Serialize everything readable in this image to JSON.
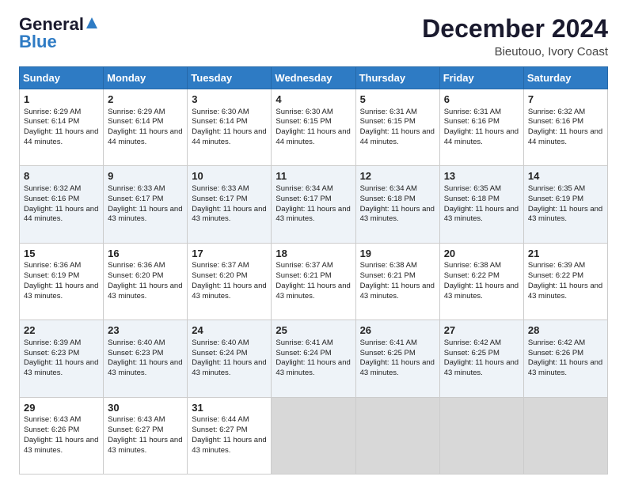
{
  "logo": {
    "line1": "General",
    "line2": "Blue"
  },
  "title": "December 2024",
  "subtitle": "Bieutouo, Ivory Coast",
  "days_of_week": [
    "Sunday",
    "Monday",
    "Tuesday",
    "Wednesday",
    "Thursday",
    "Friday",
    "Saturday"
  ],
  "weeks": [
    [
      {
        "day": "1",
        "sunrise": "6:29 AM",
        "sunset": "6:14 PM",
        "daylight": "11 hours and 44 minutes."
      },
      {
        "day": "2",
        "sunrise": "6:29 AM",
        "sunset": "6:14 PM",
        "daylight": "11 hours and 44 minutes."
      },
      {
        "day": "3",
        "sunrise": "6:30 AM",
        "sunset": "6:14 PM",
        "daylight": "11 hours and 44 minutes."
      },
      {
        "day": "4",
        "sunrise": "6:30 AM",
        "sunset": "6:15 PM",
        "daylight": "11 hours and 44 minutes."
      },
      {
        "day": "5",
        "sunrise": "6:31 AM",
        "sunset": "6:15 PM",
        "daylight": "11 hours and 44 minutes."
      },
      {
        "day": "6",
        "sunrise": "6:31 AM",
        "sunset": "6:16 PM",
        "daylight": "11 hours and 44 minutes."
      },
      {
        "day": "7",
        "sunrise": "6:32 AM",
        "sunset": "6:16 PM",
        "daylight": "11 hours and 44 minutes."
      }
    ],
    [
      {
        "day": "8",
        "sunrise": "6:32 AM",
        "sunset": "6:16 PM",
        "daylight": "11 hours and 44 minutes."
      },
      {
        "day": "9",
        "sunrise": "6:33 AM",
        "sunset": "6:17 PM",
        "daylight": "11 hours and 43 minutes."
      },
      {
        "day": "10",
        "sunrise": "6:33 AM",
        "sunset": "6:17 PM",
        "daylight": "11 hours and 43 minutes."
      },
      {
        "day": "11",
        "sunrise": "6:34 AM",
        "sunset": "6:17 PM",
        "daylight": "11 hours and 43 minutes."
      },
      {
        "day": "12",
        "sunrise": "6:34 AM",
        "sunset": "6:18 PM",
        "daylight": "11 hours and 43 minutes."
      },
      {
        "day": "13",
        "sunrise": "6:35 AM",
        "sunset": "6:18 PM",
        "daylight": "11 hours and 43 minutes."
      },
      {
        "day": "14",
        "sunrise": "6:35 AM",
        "sunset": "6:19 PM",
        "daylight": "11 hours and 43 minutes."
      }
    ],
    [
      {
        "day": "15",
        "sunrise": "6:36 AM",
        "sunset": "6:19 PM",
        "daylight": "11 hours and 43 minutes."
      },
      {
        "day": "16",
        "sunrise": "6:36 AM",
        "sunset": "6:20 PM",
        "daylight": "11 hours and 43 minutes."
      },
      {
        "day": "17",
        "sunrise": "6:37 AM",
        "sunset": "6:20 PM",
        "daylight": "11 hours and 43 minutes."
      },
      {
        "day": "18",
        "sunrise": "6:37 AM",
        "sunset": "6:21 PM",
        "daylight": "11 hours and 43 minutes."
      },
      {
        "day": "19",
        "sunrise": "6:38 AM",
        "sunset": "6:21 PM",
        "daylight": "11 hours and 43 minutes."
      },
      {
        "day": "20",
        "sunrise": "6:38 AM",
        "sunset": "6:22 PM",
        "daylight": "11 hours and 43 minutes."
      },
      {
        "day": "21",
        "sunrise": "6:39 AM",
        "sunset": "6:22 PM",
        "daylight": "11 hours and 43 minutes."
      }
    ],
    [
      {
        "day": "22",
        "sunrise": "6:39 AM",
        "sunset": "6:23 PM",
        "daylight": "11 hours and 43 minutes."
      },
      {
        "day": "23",
        "sunrise": "6:40 AM",
        "sunset": "6:23 PM",
        "daylight": "11 hours and 43 minutes."
      },
      {
        "day": "24",
        "sunrise": "6:40 AM",
        "sunset": "6:24 PM",
        "daylight": "11 hours and 43 minutes."
      },
      {
        "day": "25",
        "sunrise": "6:41 AM",
        "sunset": "6:24 PM",
        "daylight": "11 hours and 43 minutes."
      },
      {
        "day": "26",
        "sunrise": "6:41 AM",
        "sunset": "6:25 PM",
        "daylight": "11 hours and 43 minutes."
      },
      {
        "day": "27",
        "sunrise": "6:42 AM",
        "sunset": "6:25 PM",
        "daylight": "11 hours and 43 minutes."
      },
      {
        "day": "28",
        "sunrise": "6:42 AM",
        "sunset": "6:26 PM",
        "daylight": "11 hours and 43 minutes."
      }
    ],
    [
      {
        "day": "29",
        "sunrise": "6:43 AM",
        "sunset": "6:26 PM",
        "daylight": "11 hours and 43 minutes."
      },
      {
        "day": "30",
        "sunrise": "6:43 AM",
        "sunset": "6:27 PM",
        "daylight": "11 hours and 43 minutes."
      },
      {
        "day": "31",
        "sunrise": "6:44 AM",
        "sunset": "6:27 PM",
        "daylight": "11 hours and 43 minutes."
      },
      null,
      null,
      null,
      null
    ]
  ]
}
